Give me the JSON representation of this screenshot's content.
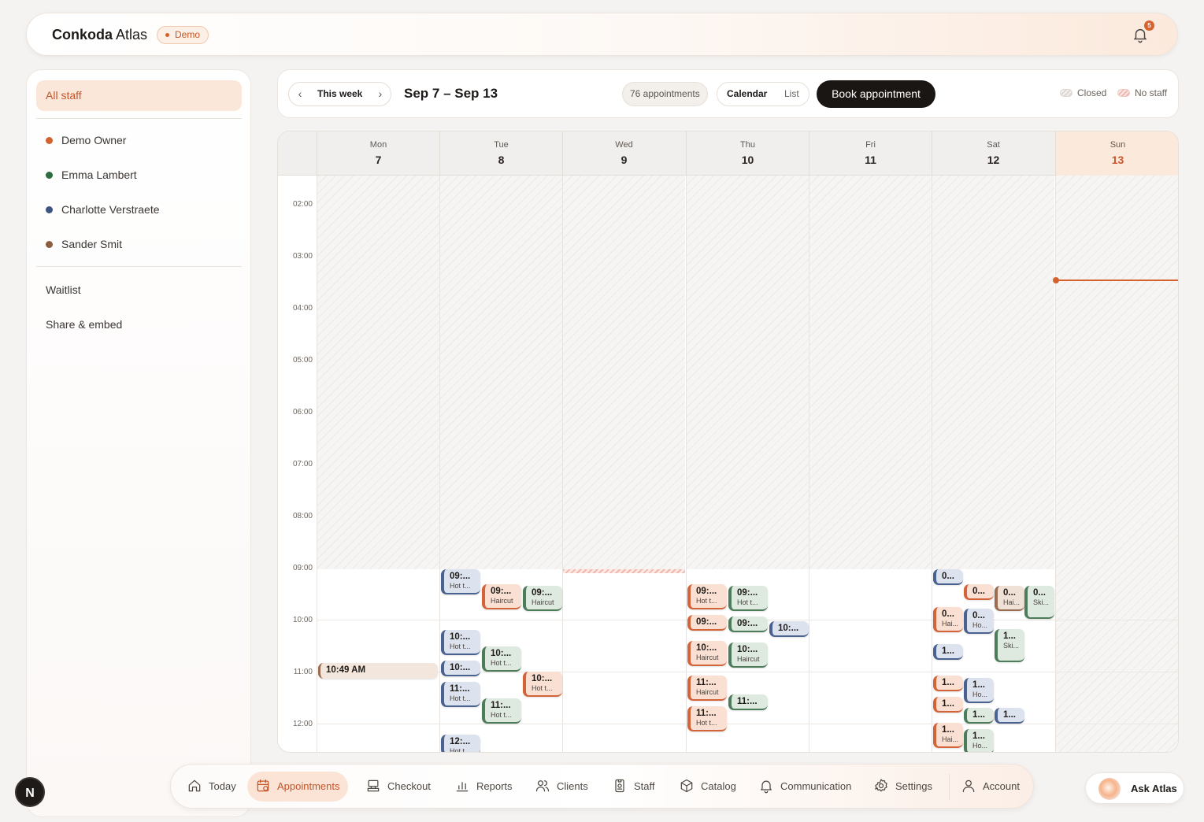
{
  "header": {
    "brand_bold": "Conkoda",
    "brand_rest": "Atlas",
    "badge": "Demo",
    "notifications": "5",
    "bell_icon": "bell-icon"
  },
  "sidebar": {
    "all_staff": "All staff",
    "staff": [
      {
        "name": "Demo Owner",
        "color": "#d4622c"
      },
      {
        "name": "Emma Lambert",
        "color": "#2f6b3f"
      },
      {
        "name": "Charlotte Verstraete",
        "color": "#3d5382"
      },
      {
        "name": "Sander Smit",
        "color": "#8a5d3f"
      }
    ],
    "links": [
      "Waitlist",
      "Share & embed"
    ]
  },
  "toolbar": {
    "week_label": "This week",
    "range": "Sep 7 – Sep 13",
    "appointments_count": "76 appointments",
    "view_calendar": "Calendar",
    "view_list": "List",
    "book": "Book appointment",
    "legend_closed": "Closed",
    "legend_nostaff": "No staff"
  },
  "calendar": {
    "days": [
      {
        "name": "Mon",
        "date": "7"
      },
      {
        "name": "Tue",
        "date": "8"
      },
      {
        "name": "Wed",
        "date": "9"
      },
      {
        "name": "Thu",
        "date": "10"
      },
      {
        "name": "Fri",
        "date": "11"
      },
      {
        "name": "Sat",
        "date": "12"
      },
      {
        "name": "Sun",
        "date": "13",
        "today": true
      }
    ],
    "hours": [
      "02:00",
      "03:00",
      "04:00",
      "05:00",
      "06:00",
      "07:00",
      "08:00",
      "09:00",
      "10:00",
      "11:00",
      "12:00"
    ],
    "current_event": "10:49 AM",
    "appointments": [
      {
        "day": "Tue",
        "time": "09:...",
        "service": "Hot t...",
        "color": "blue"
      },
      {
        "day": "Tue",
        "time": "09:...",
        "service": "Haircut",
        "color": "orange"
      },
      {
        "day": "Tue",
        "time": "09:...",
        "service": "Haircut",
        "color": "green"
      },
      {
        "day": "Tue",
        "time": "10:...",
        "service": "Hot t...",
        "color": "blue"
      },
      {
        "day": "Tue",
        "time": "10:...",
        "service": "Hot t...",
        "color": "green"
      },
      {
        "day": "Tue",
        "time": "10:...",
        "service": "",
        "color": "blue"
      },
      {
        "day": "Tue",
        "time": "10:...",
        "service": "Hot t...",
        "color": "orange"
      },
      {
        "day": "Tue",
        "time": "11:...",
        "service": "Hot t...",
        "color": "blue"
      },
      {
        "day": "Tue",
        "time": "11:...",
        "service": "Hot t...",
        "color": "green"
      },
      {
        "day": "Tue",
        "time": "12:...",
        "service": "Hot t...",
        "color": "blue"
      },
      {
        "day": "Thu",
        "time": "09:...",
        "service": "Hot t...",
        "color": "orange"
      },
      {
        "day": "Thu",
        "time": "09:...",
        "service": "Hot t...",
        "color": "green"
      },
      {
        "day": "Thu",
        "time": "09:...",
        "service": "",
        "color": "orange"
      },
      {
        "day": "Thu",
        "time": "09:...",
        "service": "",
        "color": "green"
      },
      {
        "day": "Thu",
        "time": "10:...",
        "service": "",
        "color": "blue"
      },
      {
        "day": "Thu",
        "time": "10:...",
        "service": "Haircut",
        "color": "orange"
      },
      {
        "day": "Thu",
        "time": "10:...",
        "service": "Haircut",
        "color": "green"
      },
      {
        "day": "Thu",
        "time": "11:...",
        "service": "Haircut",
        "color": "orange"
      },
      {
        "day": "Thu",
        "time": "11:...",
        "service": "",
        "color": "green"
      },
      {
        "day": "Thu",
        "time": "11:...",
        "service": "Hot t...",
        "color": "orange"
      },
      {
        "day": "Sat",
        "time": "0...",
        "service": "",
        "color": "blue"
      },
      {
        "day": "Sat",
        "time": "0...",
        "service": "",
        "color": "orange"
      },
      {
        "day": "Sat",
        "time": "0...",
        "service": "Hai...",
        "color": "brown"
      },
      {
        "day": "Sat",
        "time": "0...",
        "service": "Ski...",
        "color": "green"
      },
      {
        "day": "Sat",
        "time": "0...",
        "service": "Hai...",
        "color": "orange"
      },
      {
        "day": "Sat",
        "time": "0...",
        "service": "Ho...",
        "color": "blue"
      },
      {
        "day": "Sat",
        "time": "1...",
        "service": "",
        "color": "blue"
      },
      {
        "day": "Sat",
        "time": "1...",
        "service": "Ski...",
        "color": "green"
      },
      {
        "day": "Sat",
        "time": "1...",
        "service": "",
        "color": "orange"
      },
      {
        "day": "Sat",
        "time": "1...",
        "service": "Ho...",
        "color": "blue"
      },
      {
        "day": "Sat",
        "time": "1...",
        "service": "",
        "color": "orange"
      },
      {
        "day": "Sat",
        "time": "1...",
        "service": "",
        "color": "green"
      },
      {
        "day": "Sat",
        "time": "1...",
        "service": "",
        "color": "blue"
      },
      {
        "day": "Sat",
        "time": "1...",
        "service": "Hai...",
        "color": "orange"
      },
      {
        "day": "Sat",
        "time": "1...",
        "service": "Ho...",
        "color": "green"
      }
    ]
  },
  "nav": {
    "items": [
      {
        "label": "Today",
        "icon": "home-icon"
      },
      {
        "label": "Appointments",
        "icon": "calendar-icon",
        "active": true
      },
      {
        "label": "Checkout",
        "icon": "register-icon"
      },
      {
        "label": "Reports",
        "icon": "bar-chart-icon"
      },
      {
        "label": "Clients",
        "icon": "users-icon"
      },
      {
        "label": "Staff",
        "icon": "badge-icon"
      },
      {
        "label": "Catalog",
        "icon": "box-icon"
      },
      {
        "label": "Communication",
        "icon": "bell-icon"
      },
      {
        "label": "Settings",
        "icon": "gear-icon"
      },
      {
        "label": "Account",
        "icon": "user-icon"
      }
    ],
    "avatar": "N",
    "ask": "Ask Atlas"
  }
}
